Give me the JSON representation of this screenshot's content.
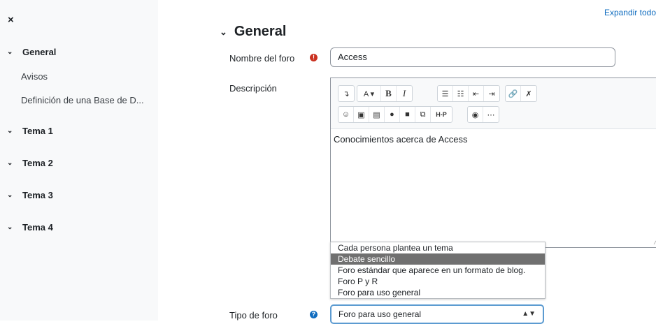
{
  "sidebar": {
    "close_label": "×",
    "sections": [
      {
        "label": "General",
        "items": [
          "Avisos",
          "Definición de una Base de D..."
        ]
      },
      {
        "label": "Tema 1"
      },
      {
        "label": "Tema 2"
      },
      {
        "label": "Tema 3"
      },
      {
        "label": "Tema 4"
      }
    ]
  },
  "header": {
    "expand_all": "Expandir todo"
  },
  "form": {
    "section_title": "General",
    "forum_name": {
      "label": "Nombre del foro",
      "value": "Access"
    },
    "description": {
      "label": "Descripción",
      "content": "Conocimientos acerca de Access"
    },
    "forum_type": {
      "label": "Tipo de foro",
      "selected": "Foro para uso general",
      "options": [
        "Cada persona plantea un tema",
        "Debate sencillo",
        "Foro estándar que aparece en un formato de blog.",
        "Foro P y R",
        "Foro para uso general"
      ],
      "highlighted_option": "Debate sencillo"
    }
  },
  "toolbar": {
    "paragraph": "↴",
    "font": "A ▾",
    "bold": "B",
    "italic": "I",
    "h5p": "H-P"
  },
  "colors": {
    "accent": "#0f6cbf",
    "required": "#ca3120",
    "highlight": "#707070"
  }
}
